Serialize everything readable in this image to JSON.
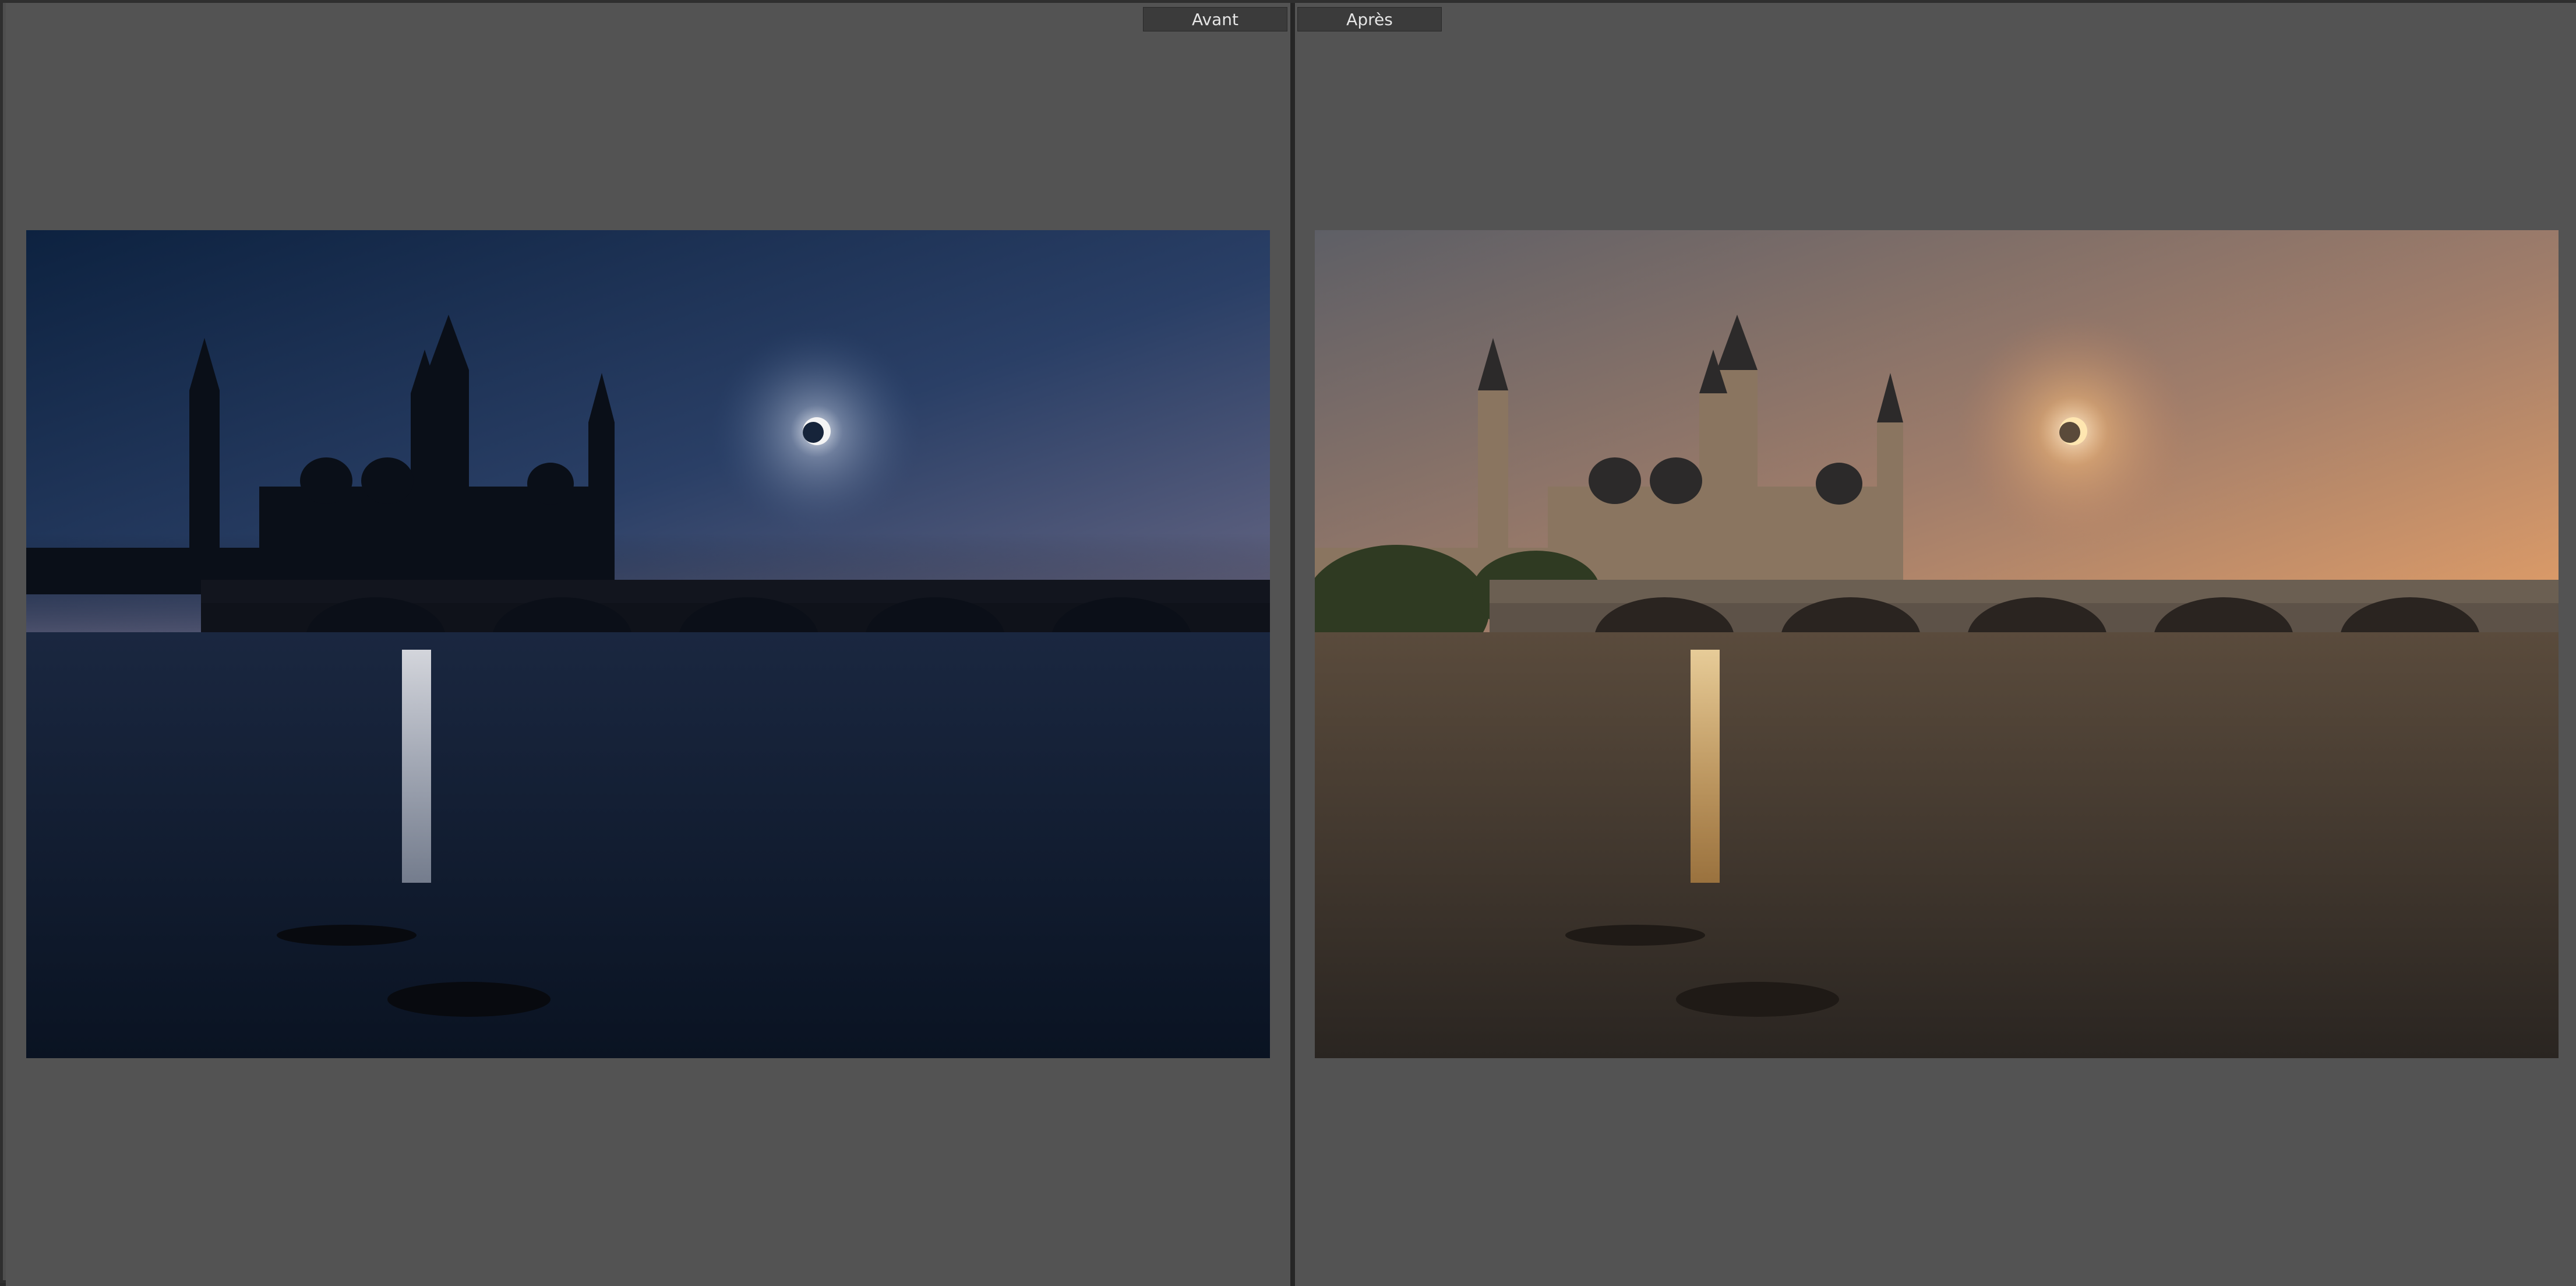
{
  "compare": {
    "before_label": "Avant",
    "after_label": "Après"
  },
  "colors": {
    "background": "#535353",
    "divider": "#262626",
    "label_bg": "#3b3b3b",
    "label_text": "#e6e6e6"
  },
  "photos": {
    "before": {
      "subject": "night-cityscape-cathedral-bridge-eclipse",
      "sky_top": "#0f2440",
      "sky_horizon": "#6b6a84",
      "water": "#0c1626"
    },
    "after": {
      "subject": "sunset-cityscape-cathedral-bridge-eclipse",
      "sky_top": "#5e5f66",
      "sky_horizon": "#e09a5a",
      "water": "#2a2622"
    }
  }
}
